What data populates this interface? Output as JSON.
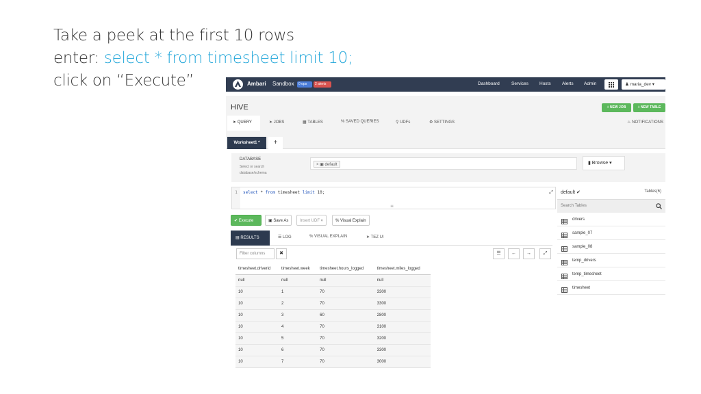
{
  "slide": {
    "line1": "Take a peek at the first 10 rows",
    "line2_prefix": "enter: ",
    "line2_query": "select * from timesheet limit 10;",
    "line3": "click on “Execute”",
    "accent_color": "#1ea5d9"
  },
  "topbar": {
    "brand": "Ambari",
    "cluster": "Sandbox",
    "ops_badge": "0 ops",
    "alerts_badge": "2 alerts",
    "nav": [
      "Dashboard",
      "Services",
      "Hosts",
      "Alerts",
      "Admin"
    ],
    "user": "maria_dev ▾",
    "bg_color": "#313d52"
  },
  "hive": {
    "title": "HIVE",
    "new_job": "+ NEW JOB",
    "new_table": "+ NEW TABLE",
    "tabs": [
      "QUERY",
      "JOBS",
      "TABLES",
      "SAVED QUERIES",
      "UDFs",
      "SETTINGS"
    ],
    "notifications": "NOTIFICATIONS",
    "worksheet_tab": "Worksheet1 *",
    "add_tab": "+"
  },
  "database": {
    "label": "DATABASE",
    "help": "Select or search database/schema",
    "selected": "default",
    "browse": "Browse ▾"
  },
  "editor": {
    "line_number": "1",
    "kw_select": "select",
    "star": "*",
    "kw_from": "from",
    "table": "timesheet",
    "kw_limit": "limit",
    "limit_value": "10;"
  },
  "actions": {
    "execute": "Execute",
    "save_as": "Save As",
    "insert_udf": "Insert UDF ▾",
    "visual_explain": "Visual Explain"
  },
  "result_tabs": [
    "RESULTS",
    "LOG",
    "VISUAL EXPLAIN",
    "TEZ UI"
  ],
  "filter": {
    "placeholder": "Filter columns",
    "clear": "✖"
  },
  "results": {
    "columns": [
      "timesheet.driverid",
      "timesheet.week",
      "timesheet.hours_logged",
      "timesheet.miles_logged"
    ],
    "rows": [
      [
        "null",
        "null",
        "null",
        "null"
      ],
      [
        "10",
        "1",
        "70",
        "3300"
      ],
      [
        "10",
        "2",
        "70",
        "3300"
      ],
      [
        "10",
        "3",
        "60",
        "2800"
      ],
      [
        "10",
        "4",
        "70",
        "3100"
      ],
      [
        "10",
        "5",
        "70",
        "3200"
      ],
      [
        "10",
        "6",
        "70",
        "3300"
      ],
      [
        "10",
        "7",
        "70",
        "3000"
      ]
    ]
  },
  "tables_panel": {
    "db": "default ✔",
    "count": "Tables(6)",
    "search_placeholder": "Search Tables",
    "items": [
      "drivers",
      "sample_07",
      "sample_08",
      "temp_drivers",
      "temp_timesheet",
      "timesheet"
    ]
  },
  "colors": {
    "execute_green": "#5cb85c",
    "dark_tab": "#2d3a4f"
  }
}
